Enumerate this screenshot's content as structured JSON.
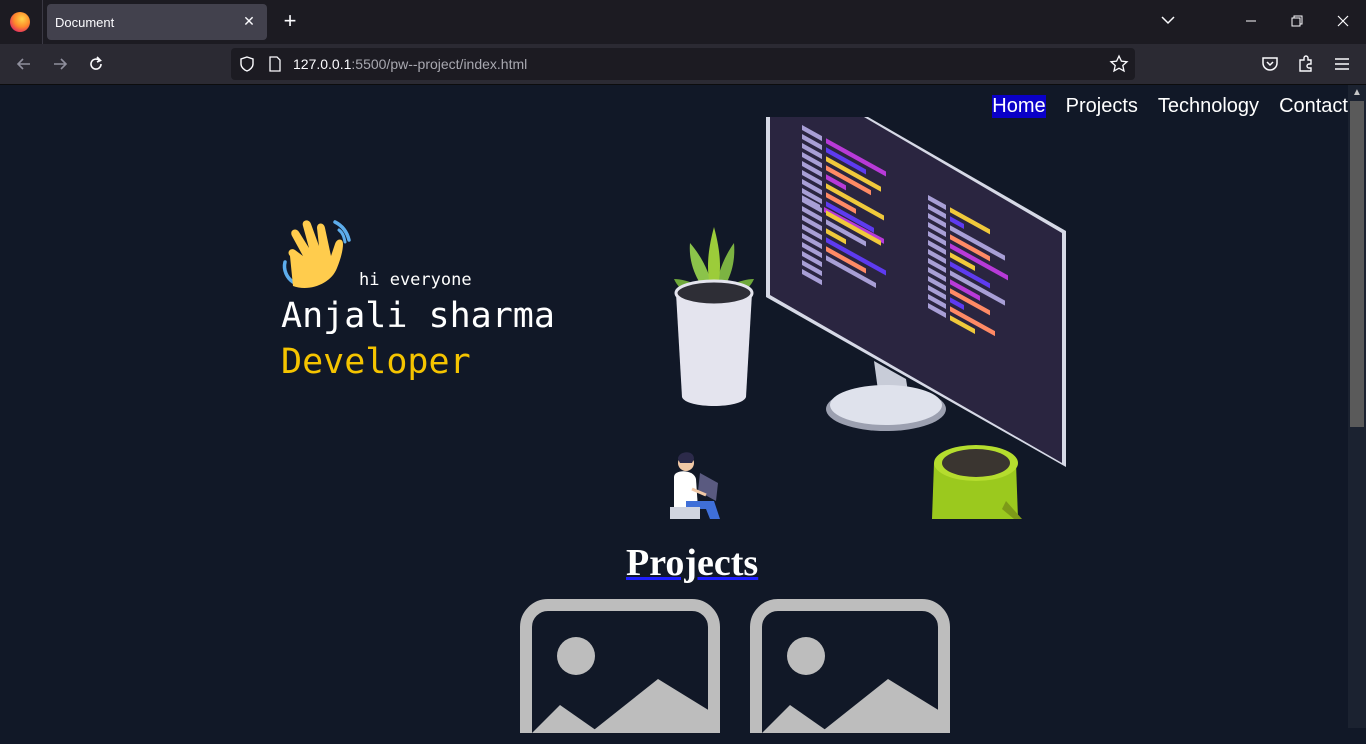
{
  "browser": {
    "tab_title": "Document",
    "tab_close": "✕",
    "new_tab": "+",
    "url_host": "127.0.0.1",
    "url_rest": ":5500/pw--project/index.html",
    "controls": {
      "list_tabs": "⌄",
      "minimize": "—",
      "restore": "❐",
      "close": "✕"
    }
  },
  "site": {
    "nav": [
      "Home",
      "Projects",
      "Technology",
      "Contact"
    ],
    "active_nav": "Home",
    "greeting": "hi everyone",
    "name": "Anjali sharma",
    "role": "Developer",
    "projects_heading": "Projects"
  },
  "colors": {
    "page_bg": "#111827",
    "accent_yellow": "#f5c400",
    "nav_active_bg": "#0a00c8",
    "underline_blue": "#1f1fff"
  },
  "icons": [
    "firefox-icon",
    "back-icon",
    "forward-icon",
    "reload-icon",
    "shield-icon",
    "page-icon",
    "star-icon",
    "pocket-icon",
    "extensions-icon",
    "menu-icon",
    "waving-hand-icon",
    "image-placeholder-icon"
  ]
}
